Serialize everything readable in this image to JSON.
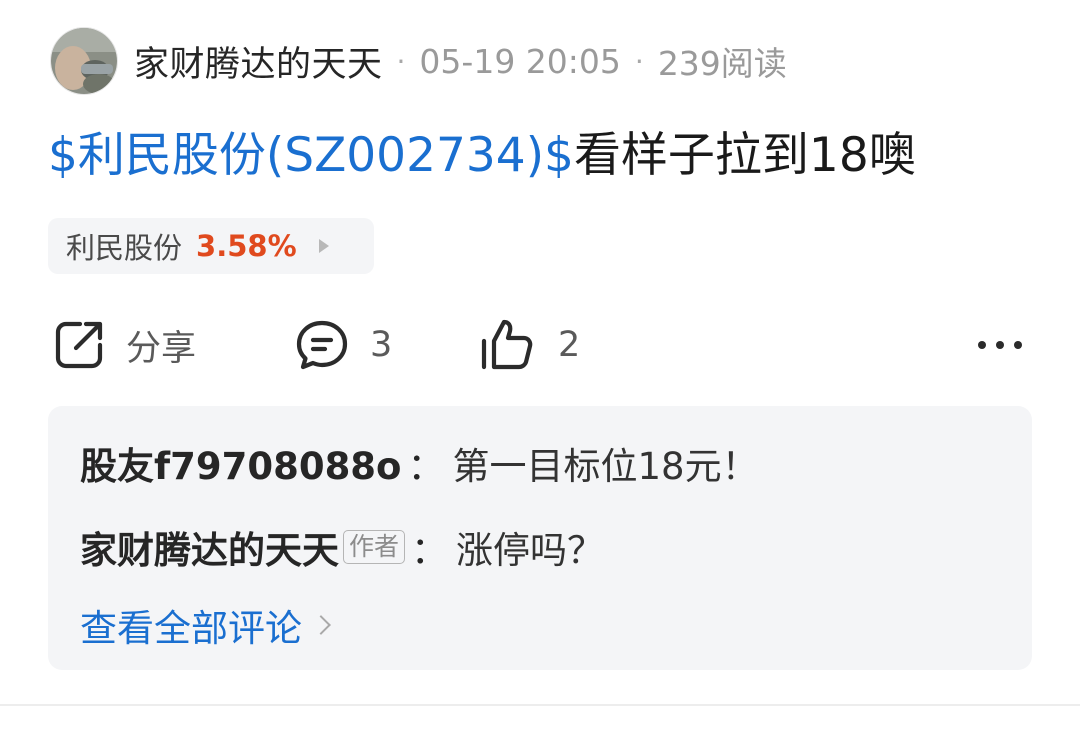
{
  "post": {
    "author": "家财腾达的天天",
    "separator": "·",
    "time": "05-19 20:05",
    "reads": "239阅读",
    "stock_tag": "$利民股份(SZ002734)$",
    "text": "看样子拉到18噢"
  },
  "stock_chip": {
    "name": "利民股份",
    "change": "3.58%",
    "change_color": "#e04a1e"
  },
  "actions": {
    "share_label": "分享",
    "comment_count": "3",
    "like_count": "2"
  },
  "icons": {
    "share": "share-icon",
    "comment": "comment-icon",
    "like": "thumbs-up-icon",
    "more": "more-icon"
  },
  "comments": [
    {
      "user": "股友f79708088o",
      "colon": "：",
      "text": "第一目标位18元！"
    },
    {
      "user": "家财腾达的天天",
      "badge": "作者",
      "colon": "：",
      "text": "涨停吗？"
    }
  ],
  "view_all_label": "查看全部评论",
  "colors": {
    "link": "#1a6fd0",
    "up": "#e04a1e",
    "panel_bg": "#f4f5f7"
  }
}
